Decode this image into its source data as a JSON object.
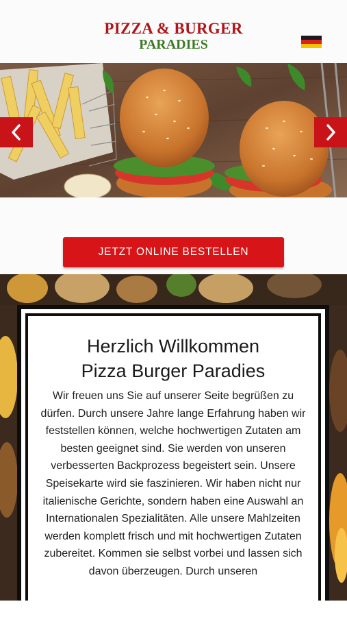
{
  "header": {
    "logo_line1": "PIZZA & BURGER",
    "logo_line2": "PARADIES",
    "language_flag": "german-flag-icon"
  },
  "slider": {
    "prev_icon": "‹",
    "next_icon": "›"
  },
  "cta": {
    "label": "JETZT ONLINE BESTELLEN"
  },
  "welcome": {
    "title_line1": "Herzlich Willkommen",
    "title_line2": "Pizza Burger Paradies",
    "text": "Wir freuen uns Sie auf unserer Seite begrüßen zu dürfen. Durch unsere Jahre lange Erfahrung haben wir feststellen können, welche hochwertigen Zutaten am besten geeignet sind. Sie werden von unseren verbesserten Backprozess begeistert sein. Unsere Speisekarte wird sie faszinieren. Wir haben nicht nur italienische Gerichte, sondern haben eine Auswahl an Internationalen Spezialitäten. Alle unsere Mahlzeiten werden komplett frisch und mit hochwertigen Zutaten zubereitet. Kommen sie selbst vorbei und lassen sich davon überzeugen. Durch unseren"
  },
  "colors": {
    "brand_red": "#b0151a",
    "brand_green": "#3d7a26",
    "button_red": "#d71418"
  }
}
